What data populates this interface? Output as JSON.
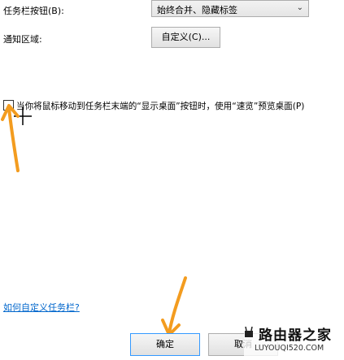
{
  "taskbar_buttons": {
    "label": "任务栏按钮(B):",
    "selected": "始终合并、隐藏标签"
  },
  "notification_area": {
    "label": "通知区域:",
    "button": "自定义(C)..."
  },
  "peek": {
    "label": "当你将鼠标移动到任务栏末端的“显示桌面”按钮时，使用“速览”预览桌面(P)",
    "checked": false
  },
  "help_link": "如何自定义任务栏?",
  "buttons": {
    "ok": "确定",
    "cancel": "取消"
  },
  "watermark": {
    "title": "路由器之家",
    "url": "LUYOUQI520.COM"
  },
  "colors": {
    "annotation_arrow": "#f39c1f",
    "link": "#0066cc"
  }
}
